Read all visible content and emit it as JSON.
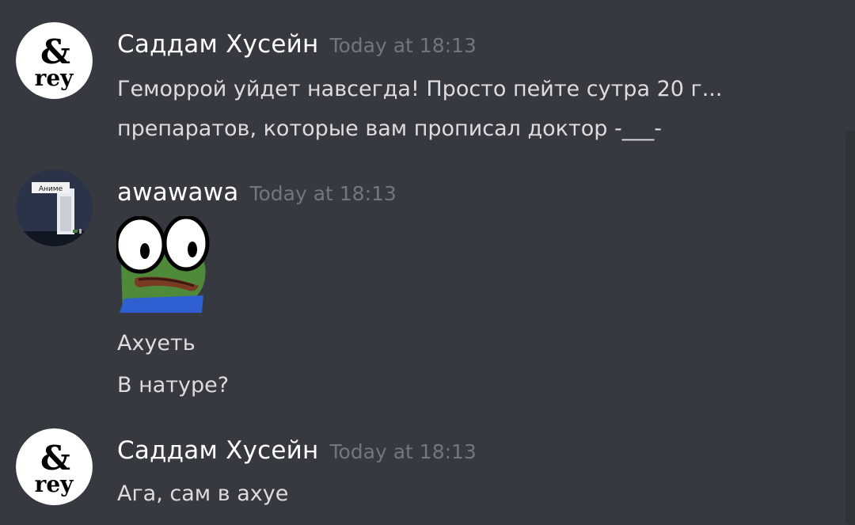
{
  "messages": [
    {
      "author": "Саддам Хусейн",
      "timestamp": "Today at 18:13",
      "avatar_icon": "ampersand-rey-logo-avatar",
      "avatar_text": "& rey",
      "lines": [
        "Геморрой уйдет навсегда! Просто пейте сутра 20 г...",
        "препаратов, которые вам прописал доктор -___-"
      ]
    },
    {
      "author": "awawawa",
      "timestamp": "Today at 18:13",
      "avatar_icon": "anime-door-avatar",
      "avatar_sign": "Аниме",
      "emoji_icon": "pepe-frog-emoji",
      "lines": [
        "Ахуеть",
        "В натуре?"
      ]
    },
    {
      "author": "Саддам Хусейн",
      "timestamp": "Today at 18:13",
      "avatar_icon": "ampersand-rey-logo-avatar",
      "avatar_text": "& rey",
      "lines": [
        "Ага, сам в ахуе"
      ]
    }
  ],
  "colors": {
    "background": "#36393f",
    "username": "#ffffff",
    "timestamp": "#72767d",
    "message_text": "#dcddde"
  }
}
